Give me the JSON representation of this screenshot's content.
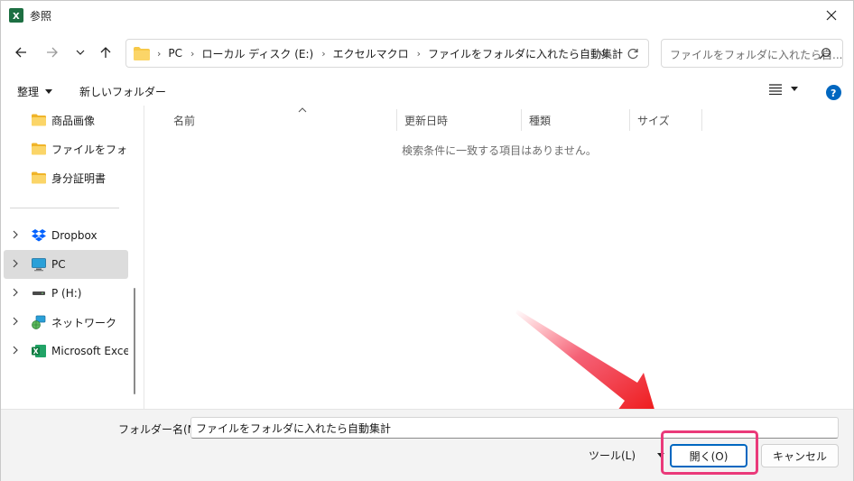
{
  "window": {
    "title": "参照"
  },
  "address": {
    "crumbs": [
      "PC",
      "ローカル ディスク (E:)",
      "エクセルマクロ",
      "ファイルをフォルダに入れたら自動集計"
    ]
  },
  "search": {
    "placeholder": "ファイルをフォルダに入れたら自..."
  },
  "toolbar": {
    "organize_label": "整理",
    "new_folder_label": "新しいフォルダー"
  },
  "sidebar": {
    "items": [
      {
        "label": "商品画像",
        "icon": "folder-icon"
      },
      {
        "label": "ファイルをフォルダに",
        "icon": "folder-icon"
      },
      {
        "label": "身分証明書",
        "icon": "folder-icon"
      },
      {
        "label": "Dropbox",
        "icon": "dropbox-icon"
      },
      {
        "label": "PC",
        "icon": "pc-icon"
      },
      {
        "label": "P (H:)",
        "icon": "drive-icon"
      },
      {
        "label": "ネットワーク",
        "icon": "network-icon"
      },
      {
        "label": "Microsoft Excel",
        "icon": "excel-icon"
      }
    ]
  },
  "columns": [
    "名前",
    "更新日時",
    "種類",
    "サイズ"
  ],
  "empty_message": "検索条件に一致する項目はありません。",
  "footer": {
    "filename_label": "フォルダー名(N):",
    "filename_value": "ファイルをフォルダに入れたら自動集計",
    "tools_label": "ツール(L)",
    "open_label": "開く(O)",
    "cancel_label": "キャンセル"
  },
  "colors": {
    "accent": "#0067c0",
    "highlight": "#ea3a7a",
    "folder": "#f7c948",
    "excel": "#1d6f42",
    "selection": "#dcdcdc"
  }
}
